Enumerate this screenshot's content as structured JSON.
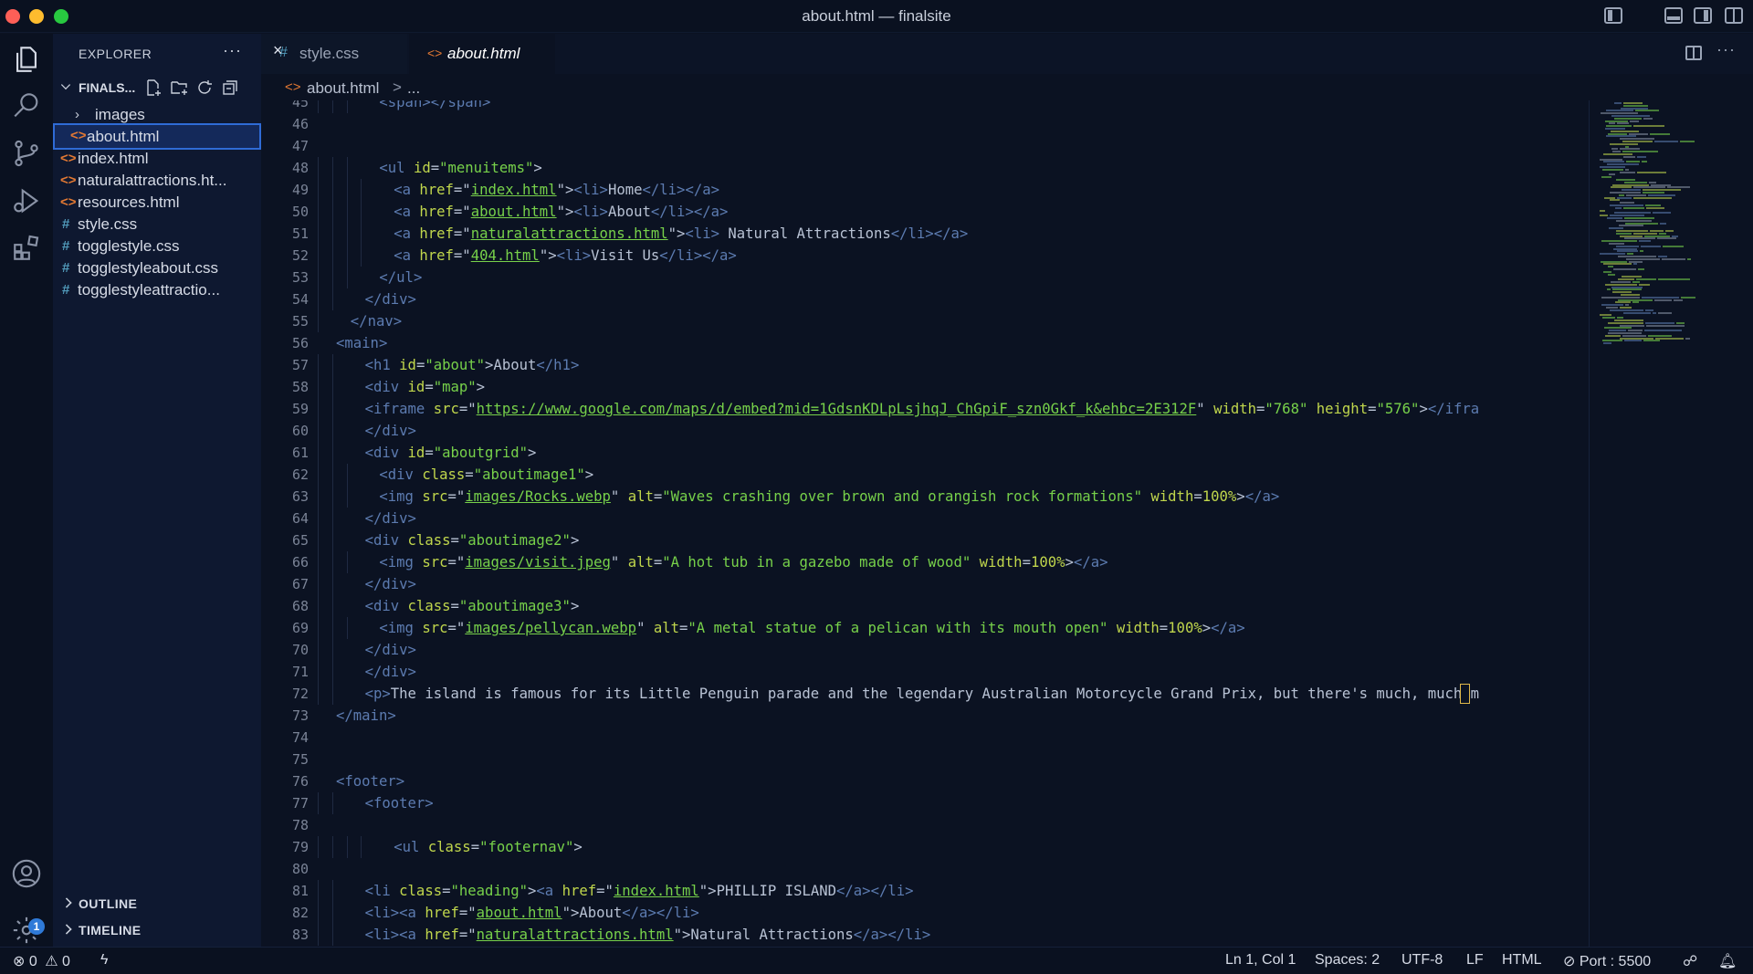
{
  "window": {
    "title": "about.html — finalsite"
  },
  "sidebar": {
    "title": "EXPLORER",
    "more": "···",
    "folder": "FINALS...",
    "items": [
      {
        "label": "images",
        "type": "folder"
      },
      {
        "label": "about.html",
        "type": "html",
        "selected": true
      },
      {
        "label": "index.html",
        "type": "html"
      },
      {
        "label": "naturalattractions.ht...",
        "type": "html"
      },
      {
        "label": "resources.html",
        "type": "html"
      },
      {
        "label": "style.css",
        "type": "css"
      },
      {
        "label": "togglestyle.css",
        "type": "css"
      },
      {
        "label": "togglestyleabout.css",
        "type": "css"
      },
      {
        "label": "togglestyleattractio...",
        "type": "css"
      }
    ],
    "sections": [
      "OUTLINE",
      "TIMELINE"
    ]
  },
  "tabs": [
    {
      "label": "style.css",
      "icon": "#"
    },
    {
      "label": "about.html",
      "icon": "<>"
    }
  ],
  "tab_close": "×",
  "editor_more": "···",
  "breadcrumb": {
    "file": "about.html",
    "separator": ">",
    "rest": "..."
  },
  "activity_badge": "1",
  "editor": {
    "line_start": 45,
    "lines": [
      {
        "n": 45,
        "indent": 3,
        "tokens": [
          [
            "t",
            "<span></span>"
          ]
        ]
      },
      {
        "n": 46,
        "indent": 0,
        "tokens": []
      },
      {
        "n": 47,
        "indent": 0,
        "tokens": []
      },
      {
        "n": 48,
        "indent": 3,
        "tokens": [
          [
            "t",
            "<ul "
          ],
          [
            "a",
            "id"
          ],
          [
            "x",
            "="
          ],
          [
            "s",
            "\"menuitems\""
          ],
          [
            "x",
            ">"
          ]
        ]
      },
      {
        "n": 49,
        "indent": 4,
        "tokens": [
          [
            "t",
            "<a "
          ],
          [
            "a",
            "href"
          ],
          [
            "x",
            "=\""
          ],
          [
            "u",
            "index.html"
          ],
          [
            "x",
            "\">"
          ],
          [
            "t",
            "<li>"
          ],
          [
            "x",
            "Home"
          ],
          [
            "t",
            "</li>"
          ],
          [
            "t",
            "</a>"
          ]
        ]
      },
      {
        "n": 50,
        "indent": 4,
        "tokens": [
          [
            "t",
            "<a "
          ],
          [
            "a",
            "href"
          ],
          [
            "x",
            "=\""
          ],
          [
            "u",
            "about.html"
          ],
          [
            "x",
            "\">"
          ],
          [
            "t",
            "<li>"
          ],
          [
            "x",
            "About"
          ],
          [
            "t",
            "</li>"
          ],
          [
            "t",
            "</a>"
          ]
        ]
      },
      {
        "n": 51,
        "indent": 4,
        "tokens": [
          [
            "t",
            "<a "
          ],
          [
            "a",
            "href"
          ],
          [
            "x",
            "=\""
          ],
          [
            "u",
            "naturalattractions.html"
          ],
          [
            "x",
            "\">"
          ],
          [
            "t",
            "<li>"
          ],
          [
            "x",
            " Natural Attractions"
          ],
          [
            "t",
            "</li>"
          ],
          [
            "t",
            "</a>"
          ]
        ]
      },
      {
        "n": 52,
        "indent": 4,
        "tokens": [
          [
            "t",
            "<a "
          ],
          [
            "a",
            "href"
          ],
          [
            "x",
            "=\""
          ],
          [
            "u",
            "404.html"
          ],
          [
            "x",
            "\">"
          ],
          [
            "t",
            "<li>"
          ],
          [
            "x",
            "Visit Us"
          ],
          [
            "t",
            "</li>"
          ],
          [
            "t",
            "</a>"
          ]
        ]
      },
      {
        "n": 53,
        "indent": 3,
        "tokens": [
          [
            "t",
            "</ul>"
          ]
        ]
      },
      {
        "n": 54,
        "indent": 2,
        "tokens": [
          [
            "t",
            "</div>"
          ]
        ]
      },
      {
        "n": 55,
        "indent": 1,
        "tokens": [
          [
            "t",
            "</nav>"
          ]
        ]
      },
      {
        "n": 56,
        "indent": 0,
        "tokens": [
          [
            "t",
            "<main>"
          ]
        ]
      },
      {
        "n": 57,
        "indent": 2,
        "tokens": [
          [
            "t",
            "<h1 "
          ],
          [
            "a",
            "id"
          ],
          [
            "x",
            "="
          ],
          [
            "s",
            "\"about\""
          ],
          [
            "x",
            ">About"
          ],
          [
            "t",
            "</h1>"
          ]
        ]
      },
      {
        "n": 58,
        "indent": 2,
        "tokens": [
          [
            "t",
            "<div "
          ],
          [
            "a",
            "id"
          ],
          [
            "x",
            "="
          ],
          [
            "s",
            "\"map\""
          ],
          [
            "x",
            ">"
          ]
        ]
      },
      {
        "n": 59,
        "indent": 2,
        "tokens": [
          [
            "t",
            "<iframe "
          ],
          [
            "a",
            "src"
          ],
          [
            "x",
            "=\""
          ],
          [
            "u",
            "https://www.google.com/maps/d/embed?mid=1GdsnKDLpLsjhqJ_ChGpiF_szn0Gkf_k&ehbc=2E312F"
          ],
          [
            "x",
            "\" "
          ],
          [
            "a",
            "width"
          ],
          [
            "x",
            "="
          ],
          [
            "s",
            "\"768\""
          ],
          [
            "x",
            " "
          ],
          [
            "a",
            "height"
          ],
          [
            "x",
            "="
          ],
          [
            "s",
            "\"576\""
          ],
          [
            "x",
            ">"
          ],
          [
            "t",
            "</ifra"
          ]
        ]
      },
      {
        "n": 60,
        "indent": 2,
        "tokens": [
          [
            "t",
            "</div>"
          ]
        ]
      },
      {
        "n": 61,
        "indent": 2,
        "tokens": [
          [
            "t",
            "<div "
          ],
          [
            "a",
            "id"
          ],
          [
            "x",
            "="
          ],
          [
            "s",
            "\"aboutgrid\""
          ],
          [
            "x",
            ">"
          ]
        ]
      },
      {
        "n": 62,
        "indent": 3,
        "tokens": [
          [
            "t",
            "<div "
          ],
          [
            "a",
            "class"
          ],
          [
            "x",
            "="
          ],
          [
            "s",
            "\"aboutimage1\""
          ],
          [
            "x",
            ">"
          ]
        ]
      },
      {
        "n": 63,
        "indent": 3,
        "tokens": [
          [
            "t",
            "<img "
          ],
          [
            "a",
            "src"
          ],
          [
            "x",
            "=\""
          ],
          [
            "u",
            "images/Rocks.webp"
          ],
          [
            "x",
            "\" "
          ],
          [
            "a",
            "alt"
          ],
          [
            "x",
            "="
          ],
          [
            "s",
            "\"Waves crashing over brown and orangish rock formations\""
          ],
          [
            "x",
            " "
          ],
          [
            "a",
            "width"
          ],
          [
            "x",
            "="
          ],
          [
            "a",
            "100%"
          ],
          [
            "x",
            ">"
          ],
          [
            "t",
            "</a>"
          ]
        ]
      },
      {
        "n": 64,
        "indent": 2,
        "tokens": [
          [
            "t",
            "</div>"
          ]
        ]
      },
      {
        "n": 65,
        "indent": 2,
        "tokens": [
          [
            "t",
            "<div "
          ],
          [
            "a",
            "class"
          ],
          [
            "x",
            "="
          ],
          [
            "s",
            "\"aboutimage2\""
          ],
          [
            "x",
            ">"
          ]
        ]
      },
      {
        "n": 66,
        "indent": 3,
        "tokens": [
          [
            "t",
            "<img "
          ],
          [
            "a",
            "src"
          ],
          [
            "x",
            "=\""
          ],
          [
            "u",
            "images/visit.jpeg"
          ],
          [
            "x",
            "\" "
          ],
          [
            "a",
            "alt"
          ],
          [
            "x",
            "="
          ],
          [
            "s",
            "\"A hot tub in a gazebo made of wood\""
          ],
          [
            "x",
            " "
          ],
          [
            "a",
            "width"
          ],
          [
            "x",
            "="
          ],
          [
            "a",
            "100%"
          ],
          [
            "x",
            ">"
          ],
          [
            "t",
            "</a>"
          ]
        ]
      },
      {
        "n": 67,
        "indent": 2,
        "tokens": [
          [
            "t",
            "</div>"
          ]
        ]
      },
      {
        "n": 68,
        "indent": 2,
        "tokens": [
          [
            "t",
            "<div "
          ],
          [
            "a",
            "class"
          ],
          [
            "x",
            "="
          ],
          [
            "s",
            "\"aboutimage3\""
          ],
          [
            "x",
            ">"
          ]
        ]
      },
      {
        "n": 69,
        "indent": 3,
        "tokens": [
          [
            "t",
            "<img "
          ],
          [
            "a",
            "src"
          ],
          [
            "x",
            "=\""
          ],
          [
            "u",
            "images/pellycan.webp"
          ],
          [
            "x",
            "\" "
          ],
          [
            "a",
            "alt"
          ],
          [
            "x",
            "="
          ],
          [
            "s",
            "\"A metal statue of a pelican with its mouth open\""
          ],
          [
            "x",
            " "
          ],
          [
            "a",
            "width"
          ],
          [
            "x",
            "="
          ],
          [
            "a",
            "100%"
          ],
          [
            "x",
            ">"
          ],
          [
            "t",
            "</a>"
          ]
        ]
      },
      {
        "n": 70,
        "indent": 2,
        "tokens": [
          [
            "t",
            "</div>"
          ]
        ]
      },
      {
        "n": 71,
        "indent": 2,
        "tokens": [
          [
            "t",
            "</div>"
          ]
        ]
      },
      {
        "n": 72,
        "indent": 2,
        "tokens": [
          [
            "t",
            "<p>"
          ],
          [
            "x",
            "The island is famous for its Little Penguin parade and the legendary Australian Motorcycle Grand Prix, but there's much, much m"
          ]
        ]
      },
      {
        "n": 73,
        "indent": 0,
        "tokens": [
          [
            "t",
            "</main>"
          ]
        ]
      },
      {
        "n": 74,
        "indent": 0,
        "tokens": []
      },
      {
        "n": 75,
        "indent": 0,
        "tokens": []
      },
      {
        "n": 76,
        "indent": 0,
        "tokens": [
          [
            "t",
            "<footer>"
          ]
        ]
      },
      {
        "n": 77,
        "indent": 2,
        "tokens": [
          [
            "t",
            "<footer>"
          ]
        ]
      },
      {
        "n": 78,
        "indent": 0,
        "tokens": []
      },
      {
        "n": 79,
        "indent": 4,
        "tokens": [
          [
            "t",
            "<ul "
          ],
          [
            "a",
            "class"
          ],
          [
            "x",
            "="
          ],
          [
            "s",
            "\"footernav\""
          ],
          [
            "x",
            ">"
          ]
        ]
      },
      {
        "n": 80,
        "indent": 0,
        "tokens": []
      },
      {
        "n": 81,
        "indent": 2,
        "tokens": [
          [
            "t",
            "<li "
          ],
          [
            "a",
            "class"
          ],
          [
            "x",
            "="
          ],
          [
            "s",
            "\"heading\""
          ],
          [
            "x",
            ">"
          ],
          [
            "t",
            "<a "
          ],
          [
            "a",
            "href"
          ],
          [
            "x",
            "=\""
          ],
          [
            "u",
            "index.html"
          ],
          [
            "x",
            "\">PHILLIP ISLAND"
          ],
          [
            "t",
            "</a>"
          ],
          [
            "t",
            "</li>"
          ]
        ]
      },
      {
        "n": 82,
        "indent": 2,
        "tokens": [
          [
            "t",
            "<li>"
          ],
          [
            "t",
            "<a "
          ],
          [
            "a",
            "href"
          ],
          [
            "x",
            "=\""
          ],
          [
            "u",
            "about.html"
          ],
          [
            "x",
            "\">About"
          ],
          [
            "t",
            "</a>"
          ],
          [
            "t",
            "</li>"
          ]
        ]
      },
      {
        "n": 83,
        "indent": 2,
        "tokens": [
          [
            "t",
            "<li>"
          ],
          [
            "t",
            "<a "
          ],
          [
            "a",
            "href"
          ],
          [
            "x",
            "=\""
          ],
          [
            "u",
            "naturalattractions.html"
          ],
          [
            "x",
            "\">Natural Attractions"
          ],
          [
            "t",
            "</a>"
          ],
          [
            "t",
            "</li>"
          ]
        ]
      }
    ]
  },
  "statusbar": {
    "errors": "0",
    "warnings": "0",
    "position": "Ln 1, Col 1",
    "spaces": "Spaces: 2",
    "encoding": "UTF-8",
    "eol": "LF",
    "language": "HTML",
    "port": "Port : 5500"
  },
  "colors": {
    "accent": "#2f6bd6",
    "html_icon": "#e37933",
    "css_icon": "#519aba",
    "tag": "#5c7bb0",
    "attribute": "#c0d64c",
    "string": "#77d14a"
  }
}
